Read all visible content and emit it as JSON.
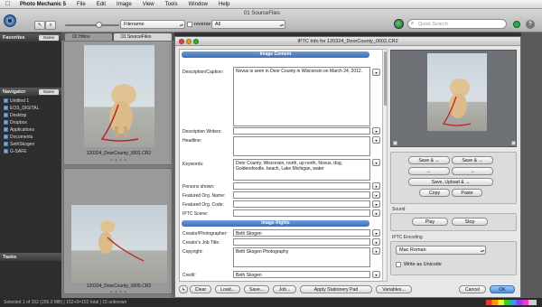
{
  "menubar": {
    "apple": "",
    "items": [
      "Photo Mechanic 5",
      "File",
      "Edit",
      "Image",
      "View",
      "Tools",
      "Window",
      "Help"
    ]
  },
  "window": {
    "title": "01 SourceFiles"
  },
  "toolbar": {
    "sort_value": "Filename",
    "reverse_label": "reverse",
    "filter_value": "All",
    "search_placeholder": "Quick Search"
  },
  "left_panel": {
    "favorites_label": "Favorites",
    "navigator_label": "Navigator",
    "name_button": "Name",
    "nav_items": [
      "Untitled 1",
      "EOS_DIGITAL",
      "Desktop",
      "Dropbox",
      "Applications",
      "Documents",
      "SethSkogen",
      "G-SAFE"
    ],
    "tasks_label": "Tasks"
  },
  "contact_sheet": {
    "tabs": [
      "02 Hitlos",
      "01 SourceFiles"
    ],
    "thumbs": [
      {
        "caption": "120324_DoorCounty_0001.CR2"
      },
      {
        "caption": "120324_DoorCounty_0005.CR2"
      }
    ],
    "dots": "• • • •"
  },
  "dialog": {
    "title": "IPTC Info for 120324_DoorCounty_0002.CR2",
    "sections": {
      "content": "Image Content",
      "rights": "Image Rights"
    },
    "fields": [
      {
        "label": "Description/Caption:",
        "value": "Novus is seen in Door County in Wisconsin on March 24, 2012."
      },
      {
        "label": "Description Writers:",
        "value": ""
      },
      {
        "label": "Headline:",
        "value": ""
      },
      {
        "label": "Keywords:",
        "value": "Door County, Wisconsin, north, up north, Novus, dog, Goldendoodle, beach, Lake Michigan, water"
      },
      {
        "label": "Persons shown:",
        "value": ""
      },
      {
        "label": "Featured Org. Name:",
        "value": ""
      },
      {
        "label": "Featured Org. Code:",
        "value": ""
      },
      {
        "label": "IPTC Scene:",
        "value": ""
      },
      {
        "label": "Creator/Photographer:",
        "value": "Beth Skogen"
      },
      {
        "label": "Creator's Job Title:",
        "value": ""
      },
      {
        "label": "Copyright:",
        "value": "Beth Skogen Photography"
      },
      {
        "label": "Credit:",
        "value": "Beth Skogen"
      }
    ],
    "bottom_buttons": {
      "clear": "Clear",
      "load": "Load...",
      "save": "Save...",
      "job": "Job...",
      "stationery": "Apply Stationery Pad",
      "variables": "Variables...",
      "cancel": "Cancel",
      "ok": "OK"
    },
    "nav_buttons": {
      "save_prev": "Save & ←",
      "save_next": "Save & →",
      "prev": "←",
      "next": "→",
      "save_upload": "Save, Upload & →",
      "copy": "Copy",
      "paste": "Paste"
    },
    "sound": {
      "label": "Sound",
      "play": "Play",
      "stop": "Stop"
    },
    "encoding": {
      "label": "IPTC Encoding",
      "value": "Mac Roman",
      "unicode_label": "Write as Unicode"
    }
  },
  "status_bar": {
    "text": "Selected 1 of 152 (206.0 MB) | 152+0=152 total | 15 unknown"
  },
  "colors": {
    "accent": "#3f6fb5",
    "section_header": "#5a88cc",
    "bg": "#3a3a3a"
  }
}
